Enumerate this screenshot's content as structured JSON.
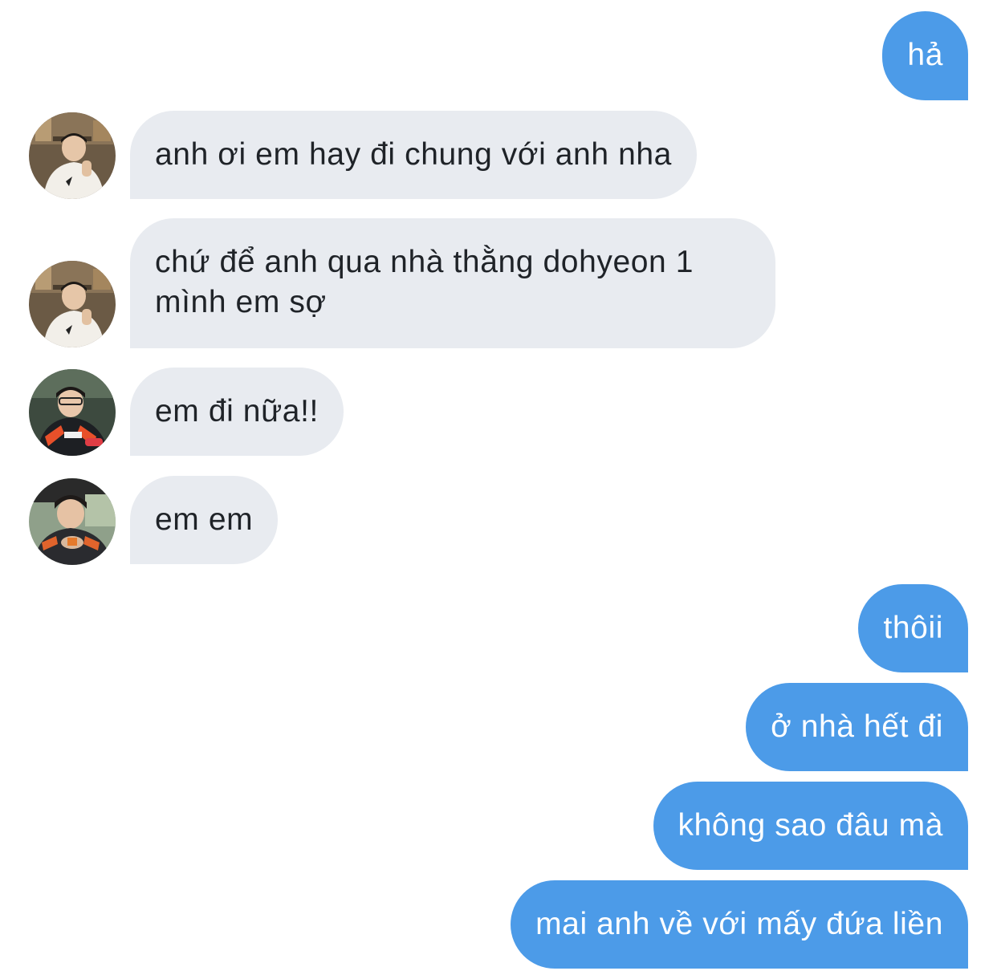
{
  "messages": [
    {
      "id": "m1",
      "direction": "outgoing",
      "text": "hả"
    },
    {
      "id": "m2",
      "direction": "incoming",
      "sender_avatar": "avatar-a",
      "text": "anh ơi em hay đi chung với anh nha"
    },
    {
      "id": "m3",
      "direction": "incoming",
      "sender_avatar": "avatar-a",
      "text": "chứ để anh qua nhà thằng dohyeon 1 mình em sợ"
    },
    {
      "id": "m4",
      "direction": "incoming",
      "sender_avatar": "avatar-b",
      "text": "em đi nữa!!"
    },
    {
      "id": "m5",
      "direction": "incoming",
      "sender_avatar": "avatar-c",
      "text": "em em"
    },
    {
      "id": "m6",
      "direction": "outgoing",
      "text": "thôii"
    },
    {
      "id": "m7",
      "direction": "outgoing",
      "text": "ở nhà hết đi"
    },
    {
      "id": "m8",
      "direction": "outgoing",
      "text": "không sao đâu mà"
    },
    {
      "id": "m9",
      "direction": "outgoing",
      "text": "mai anh về với mấy đứa liền"
    }
  ],
  "colors": {
    "outgoing_bubble": "#4c9be8",
    "incoming_bubble": "#e8ebf0",
    "outgoing_text": "#ffffff",
    "incoming_text": "#1f2328",
    "background": "#ffffff"
  }
}
